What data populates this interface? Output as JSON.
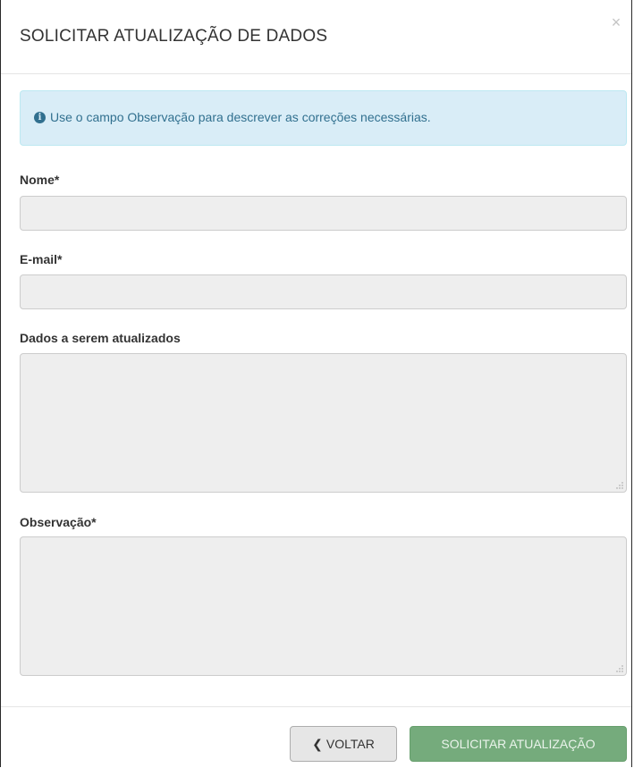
{
  "modal": {
    "title": "SOLICITAR ATUALIZAÇÃO DE DADOS",
    "close_icon": "×"
  },
  "alert": {
    "icon": "i",
    "text": "Use o campo Observação para descrever as correções necessárias."
  },
  "form": {
    "nome_label": "Nome*",
    "nome_value": "",
    "email_label": "E-mail*",
    "email_value": "",
    "dados_label": "Dados a serem atualizados",
    "dados_value": "",
    "observacao_label": "Observação*",
    "observacao_value": ""
  },
  "footer": {
    "back_icon": "❮",
    "back_label": "VOLTAR",
    "submit_label": "SOLICITAR ATUALIZAÇÃO"
  },
  "colors": {
    "alert_bg": "#d9edf7",
    "alert_text": "#31708f",
    "submit_bg": "#6ea775",
    "input_bg": "#eeeeee"
  }
}
